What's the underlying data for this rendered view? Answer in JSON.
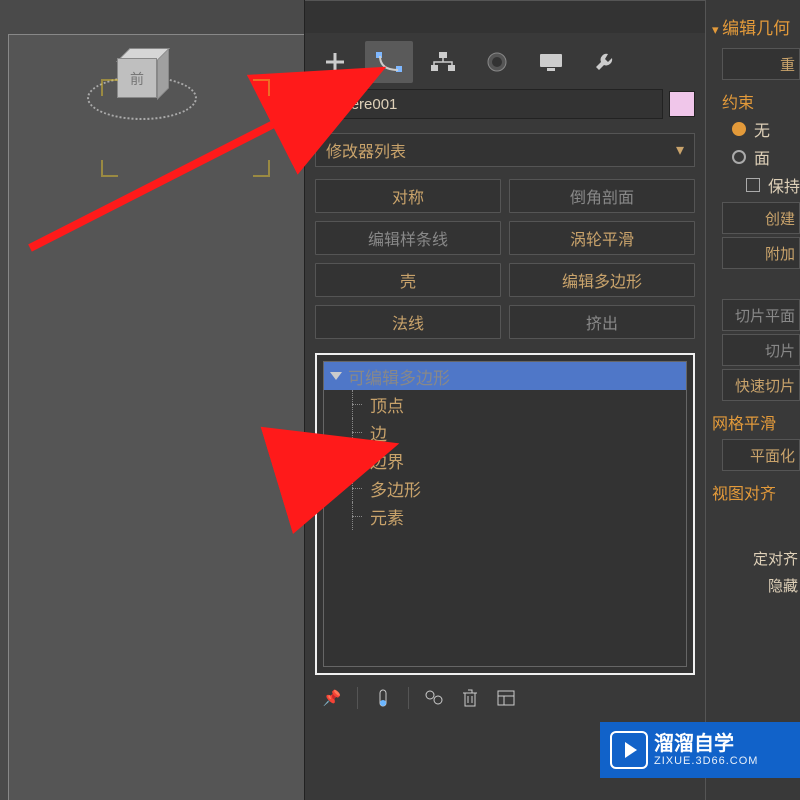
{
  "object_name": "Sphere001",
  "color_swatch": "#f0c6ea",
  "modifier_list_label": "修改器列表",
  "modifier_buttons": [
    {
      "label": "对称",
      "dim": false
    },
    {
      "label": "倒角剖面",
      "dim": true
    },
    {
      "label": "编辑样条线",
      "dim": true
    },
    {
      "label": "涡轮平滑",
      "dim": false
    },
    {
      "label": "壳",
      "dim": false
    },
    {
      "label": "编辑多边形",
      "dim": false
    },
    {
      "label": "法线",
      "dim": false
    },
    {
      "label": "挤出",
      "dim": true
    }
  ],
  "stack": {
    "root": "可编辑多边形",
    "subs": [
      "顶点",
      "边",
      "边界",
      "多边形",
      "元素"
    ]
  },
  "tabs": [
    "create",
    "modify",
    "hierarchy",
    "motion",
    "display",
    "utilities"
  ],
  "active_tab": 1,
  "right_panel": {
    "title": "编辑几何",
    "reset": "重",
    "constraint_label": "约束",
    "constraint_options": [
      {
        "label": "无",
        "on": true
      },
      {
        "label": "面",
        "on": false
      }
    ],
    "preserve": "保持",
    "buttons1": [
      "创建",
      "附加"
    ],
    "buttons2": [
      "切片平面",
      "切片",
      "快速切片"
    ],
    "section2": "网格平滑",
    "buttons3": [
      "平面化"
    ],
    "section3": "视图对齐",
    "bottom_fragments": [
      "定对齐",
      "隐藏"
    ]
  },
  "watermark": {
    "line1": "溜溜自学",
    "line2": "ZIXUE.3D66.COM"
  },
  "viewport_face_label": "前"
}
